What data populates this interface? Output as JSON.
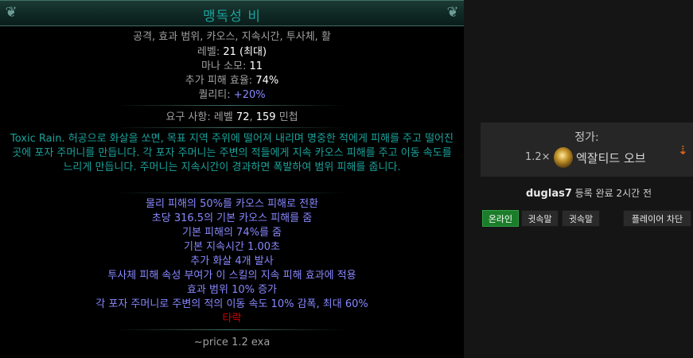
{
  "tooltip": {
    "title": "맹독성 비",
    "tags": "공격, 효과 범위, 카오스, 지속시간, 투사체, 활",
    "level_label": "레벨: ",
    "level_value": "21 (최대)",
    "mana_label": "마나 소모: ",
    "mana_value": "11",
    "effectiveness_label": "추가 피해 효율: ",
    "effectiveness_value": "74%",
    "quality_label": "퀄리티: ",
    "quality_value": "+20%",
    "requirements_prefix": "요구 사항: 레벨 ",
    "requirements_level": "72",
    "requirements_sep": ", ",
    "requirements_dex": "159",
    "requirements_suffix": " 민첩",
    "description": "Toxic Rain. 허공으로 화살을 쏘면, 목표 지역 주위에 떨어져 내리며 명중한 적에게 피해를 주고 떨어진 곳에 포자 주머니를 만듭니다. 각 포자 주머니는 주변의 적들에게 지속 카오스 피해를 주고 이동 속도를 느리게 만듭니다. 주머니는 지속시간이 경과하면 폭발하여 범위 피해를 줍니다.",
    "mods": [
      "물리 피해의 50%를 카오스 피해로 전환",
      "초당 316.5의 기본 카오스 피해를 줌",
      "기본 피해의 74%를 줌",
      "기본 지속시간 1.00초",
      "추가 화살 4개 발사",
      "투사체 피해 속성 부여가 이 스킬의 지속 피해 효과에 적용",
      "효과 범위 10% 증가",
      "각 포자 주머니로 주변의 적의 이동 속도 10% 감폭, 최대 60%"
    ],
    "corrupted": "타락",
    "note": "~price 1.2 exa"
  },
  "listing": {
    "price_label": "정가:",
    "price_amount": "1.2×",
    "currency_icon": "exalted-orb-icon",
    "currency_name": "엑잘티드 오브",
    "seller": "duglas7",
    "listed_text": " 등록 완료 2시간 전",
    "buttons": {
      "online": "온라인",
      "whisper1": "귓속말",
      "whisper2": "귓속말",
      "block": "플레이어 차단"
    }
  },
  "colors": {
    "title_teal": "#1ba29b",
    "mod_blue": "#8888ff",
    "corrupted_red": "#d20000",
    "online_green": "#1b7d2a"
  }
}
